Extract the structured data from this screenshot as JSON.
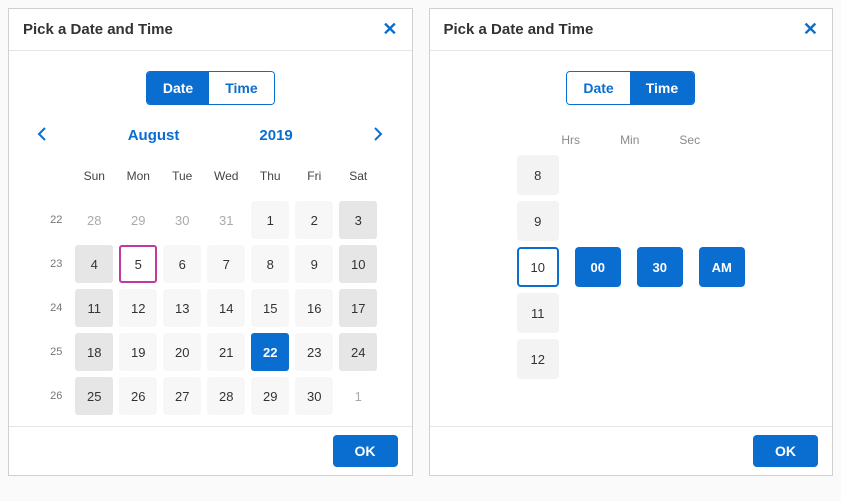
{
  "left": {
    "title": "Pick a Date and Time",
    "tabs": {
      "date": "Date",
      "time": "Time"
    },
    "month": "August",
    "year": "2019",
    "dow": [
      "Sun",
      "Mon",
      "Tue",
      "Wed",
      "Thu",
      "Fri",
      "Sat"
    ],
    "weeks": [
      "22",
      "23",
      "24",
      "25",
      "26"
    ],
    "grid": [
      [
        {
          "n": "28",
          "cls": "out"
        },
        {
          "n": "29",
          "cls": "out"
        },
        {
          "n": "30",
          "cls": "out"
        },
        {
          "n": "31",
          "cls": "out"
        },
        {
          "n": "1"
        },
        {
          "n": "2"
        },
        {
          "n": "3",
          "cls": "wknd"
        }
      ],
      [
        {
          "n": "4",
          "cls": "wknd"
        },
        {
          "n": "5",
          "cls": "today"
        },
        {
          "n": "6"
        },
        {
          "n": "7"
        },
        {
          "n": "8"
        },
        {
          "n": "9"
        },
        {
          "n": "10",
          "cls": "wknd"
        }
      ],
      [
        {
          "n": "11",
          "cls": "wknd"
        },
        {
          "n": "12"
        },
        {
          "n": "13"
        },
        {
          "n": "14"
        },
        {
          "n": "15"
        },
        {
          "n": "16"
        },
        {
          "n": "17",
          "cls": "wknd"
        }
      ],
      [
        {
          "n": "18",
          "cls": "wknd"
        },
        {
          "n": "19"
        },
        {
          "n": "20"
        },
        {
          "n": "21"
        },
        {
          "n": "22",
          "cls": "sel"
        },
        {
          "n": "23"
        },
        {
          "n": "24",
          "cls": "wknd"
        }
      ],
      [
        {
          "n": "25",
          "cls": "wknd"
        },
        {
          "n": "26"
        },
        {
          "n": "27"
        },
        {
          "n": "28"
        },
        {
          "n": "29"
        },
        {
          "n": "30"
        },
        {
          "n": "1",
          "cls": "out"
        }
      ]
    ],
    "ok": "OK"
  },
  "right": {
    "title": "Pick a Date and Time",
    "tabs": {
      "date": "Date",
      "time": "Time"
    },
    "labels": {
      "hrs": "Hrs",
      "min": "Min",
      "sec": "Sec"
    },
    "hours": [
      "8",
      "9",
      "10",
      "11",
      "12"
    ],
    "hour_sel": "10",
    "min_sel": "00",
    "sec_sel": "30",
    "ampm": "AM",
    "ok": "OK"
  }
}
